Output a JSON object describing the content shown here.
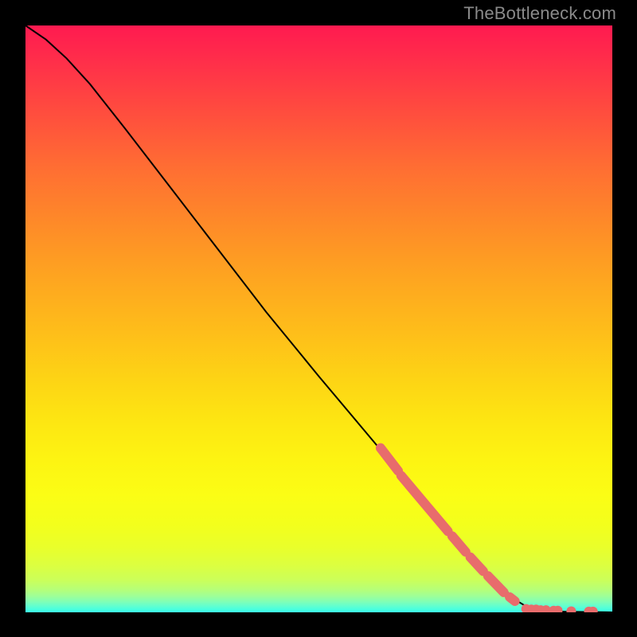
{
  "attribution": "TheBottleneck.com",
  "chart_data": {
    "type": "line",
    "title": "",
    "xlabel": "",
    "ylabel": "",
    "xlim": [
      0,
      100
    ],
    "ylim": [
      0,
      100
    ],
    "background_gradient_stops": [
      {
        "offset": 0.0,
        "color": "#ff1a50"
      },
      {
        "offset": 0.06,
        "color": "#ff2e4a"
      },
      {
        "offset": 0.14,
        "color": "#ff4a3f"
      },
      {
        "offset": 0.24,
        "color": "#ff6d33"
      },
      {
        "offset": 0.34,
        "color": "#fe8b28"
      },
      {
        "offset": 0.43,
        "color": "#fea520"
      },
      {
        "offset": 0.52,
        "color": "#febd1a"
      },
      {
        "offset": 0.6,
        "color": "#fdd315"
      },
      {
        "offset": 0.67,
        "color": "#fde512"
      },
      {
        "offset": 0.74,
        "color": "#fdf412"
      },
      {
        "offset": 0.8,
        "color": "#fbfd15"
      },
      {
        "offset": 0.85,
        "color": "#f3ff1c"
      },
      {
        "offset": 0.89,
        "color": "#e9ff2b"
      },
      {
        "offset": 0.92,
        "color": "#dcff40"
      },
      {
        "offset": 0.945,
        "color": "#cbff5a"
      },
      {
        "offset": 0.961,
        "color": "#b6ff78"
      },
      {
        "offset": 0.973,
        "color": "#9cff99"
      },
      {
        "offset": 0.982,
        "color": "#80ffb6"
      },
      {
        "offset": 0.989,
        "color": "#63ffce"
      },
      {
        "offset": 0.994,
        "color": "#4dffdd"
      },
      {
        "offset": 0.998,
        "color": "#3fffe4"
      },
      {
        "offset": 1.0,
        "color": "#44ffe1"
      }
    ],
    "curve_points": [
      {
        "x": 0.0,
        "y": 100.0
      },
      {
        "x": 3.5,
        "y": 97.6
      },
      {
        "x": 7.0,
        "y": 94.4
      },
      {
        "x": 11.0,
        "y": 90.0
      },
      {
        "x": 17.0,
        "y": 82.4
      },
      {
        "x": 25.0,
        "y": 72.0
      },
      {
        "x": 33.0,
        "y": 61.6
      },
      {
        "x": 41.0,
        "y": 51.2
      },
      {
        "x": 50.0,
        "y": 40.2
      },
      {
        "x": 59.0,
        "y": 29.5
      },
      {
        "x": 66.0,
        "y": 21.2
      },
      {
        "x": 73.0,
        "y": 13.1
      },
      {
        "x": 79.0,
        "y": 6.5
      },
      {
        "x": 83.5,
        "y": 2.1
      },
      {
        "x": 86.0,
        "y": 0.6
      },
      {
        "x": 88.0,
        "y": 0.2
      },
      {
        "x": 92.0,
        "y": 0.1
      },
      {
        "x": 100.0,
        "y": 0.0
      }
    ],
    "scatter_segments": [
      {
        "x1": 60.5,
        "y1": 28.0,
        "x2": 63.5,
        "y2": 24.1
      },
      {
        "x1": 64.0,
        "y1": 23.3,
        "x2": 72.0,
        "y2": 13.8
      },
      {
        "x1": 72.7,
        "y1": 13.0,
        "x2": 75.0,
        "y2": 10.3
      },
      {
        "x1": 75.8,
        "y1": 9.4,
        "x2": 78.0,
        "y2": 7.0
      },
      {
        "x1": 78.8,
        "y1": 6.2,
        "x2": 81.5,
        "y2": 3.4
      },
      {
        "x1": 82.5,
        "y1": 2.6,
        "x2": 83.4,
        "y2": 1.9
      }
    ],
    "scatter_flat_points": [
      {
        "x": 85.3,
        "y": 0.6
      },
      {
        "x": 86.2,
        "y": 0.5
      },
      {
        "x": 87.0,
        "y": 0.5
      },
      {
        "x": 87.8,
        "y": 0.4
      },
      {
        "x": 88.7,
        "y": 0.4
      },
      {
        "x": 90.0,
        "y": 0.3
      },
      {
        "x": 90.7,
        "y": 0.3
      },
      {
        "x": 93.0,
        "y": 0.2
      },
      {
        "x": 96.0,
        "y": 0.15
      },
      {
        "x": 96.7,
        "y": 0.15
      }
    ],
    "scatter_color": "#e86c6c",
    "scatter_radius": 6
  }
}
